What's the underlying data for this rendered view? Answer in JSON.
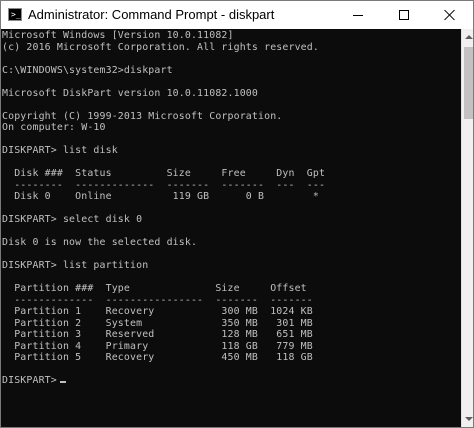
{
  "window": {
    "title": "Administrator: Command Prompt - diskpart",
    "icon": "cmd-icon",
    "icon_glyph": ">_"
  },
  "console": {
    "lines": [
      "Microsoft Windows [Version 10.0.11082]",
      "(c) 2016 Microsoft Corporation. All rights reserved.",
      "",
      "C:\\WINDOWS\\system32>diskpart",
      "",
      "Microsoft DiskPart version 10.0.11082.1000",
      "",
      "Copyright (C) 1999-2013 Microsoft Corporation.",
      "On computer: W-10",
      "",
      "DISKPART> list disk",
      "",
      "  Disk ###  Status         Size     Free     Dyn  Gpt",
      "  --------  -------------  -------  -------  ---  ---",
      "  Disk 0    Online          119 GB      0 B        *",
      "",
      "DISKPART> select disk 0",
      "",
      "Disk 0 is now the selected disk.",
      "",
      "DISKPART> list partition",
      "",
      "  Partition ###  Type              Size     Offset",
      "  -------------  ----------------  -------  -------",
      "  Partition 1    Recovery           300 MB  1024 KB",
      "  Partition 2    System             350 MB   301 MB",
      "  Partition 3    Reserved           128 MB   651 MB",
      "  Partition 4    Primary            118 GB   779 MB",
      "  Partition 5    Recovery           450 MB   118 GB",
      "",
      "DISKPART> "
    ]
  },
  "colors": {
    "console_bg": "#0c0c0c",
    "console_fg": "#c0c0c0",
    "titlebar_bg": "#ffffff"
  }
}
